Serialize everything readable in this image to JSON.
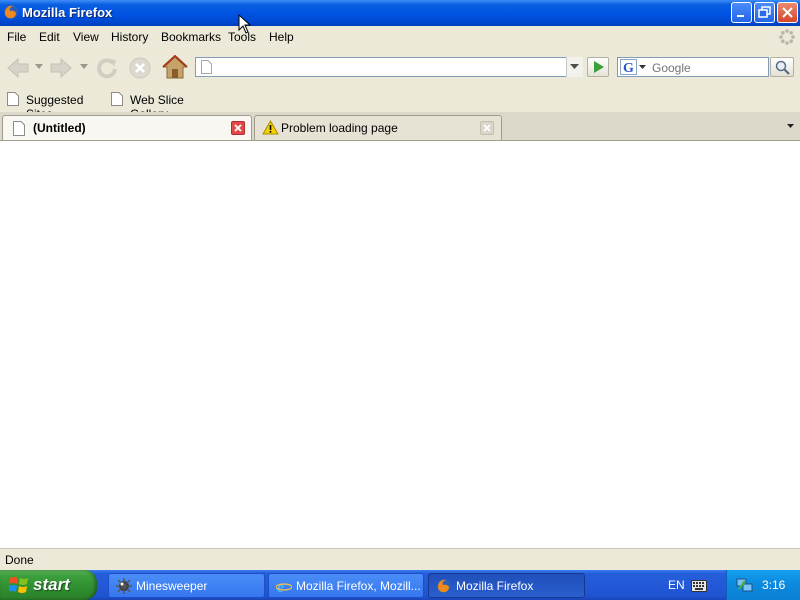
{
  "window": {
    "title": "Mozilla Firefox"
  },
  "menu": [
    "File",
    "Edit",
    "View",
    "History",
    "Bookmarks",
    "Tools",
    "Help"
  ],
  "nav": {
    "url_value": "",
    "search_engine": "Google",
    "search_placeholder": "Google"
  },
  "bookmarks": [
    "Suggested Sites",
    "Web Slice Gallery"
  ],
  "tabs": [
    {
      "label": "(Untitled)",
      "active": true
    },
    {
      "label": "Problem loading page",
      "active": false
    }
  ],
  "status": {
    "text": "Done"
  },
  "taskbar": {
    "start_label": "start",
    "tasks": [
      {
        "label": "Minesweeper",
        "active": false
      },
      {
        "label": "Mozilla Firefox, Mozill...",
        "active": false
      },
      {
        "label": "Mozilla Firefox",
        "active": true
      }
    ],
    "language": "EN",
    "clock": "3:16"
  },
  "colors": {
    "titlebar": "#0054e3",
    "taskbar": "#245edb",
    "start": "#3c9e3c",
    "tray": "#0d8ce0",
    "chrome": "#ece9d8"
  }
}
